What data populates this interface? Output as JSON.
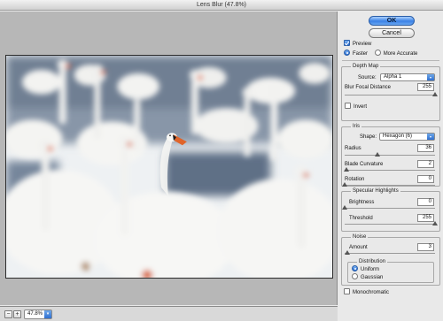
{
  "window": {
    "title": "Lens Blur (47.8%)"
  },
  "buttons": {
    "ok": "OK",
    "cancel": "Cancel"
  },
  "preview": {
    "label": "Preview",
    "checked": true,
    "mode_options": [
      "Faster",
      "More Accurate"
    ],
    "mode_selected": "Faster"
  },
  "depth_map": {
    "title": "Depth Map",
    "source_label": "Source:",
    "source_value": "Alpha 1",
    "focal_label": "Blur Focal Distance",
    "focal_value": "255",
    "focal_max": 255,
    "invert_label": "Invert",
    "invert_checked": false
  },
  "iris": {
    "title": "Iris",
    "shape_label": "Shape:",
    "shape_value": "Hexagon (6)",
    "radius_label": "Radius",
    "radius_value": "36",
    "radius_max": 100,
    "curvature_label": "Blade Curvature",
    "curvature_value": "2",
    "curvature_max": 100,
    "rotation_label": "Rotation",
    "rotation_value": "0",
    "rotation_max": 360
  },
  "specular": {
    "title": "Specular Highlights",
    "brightness_label": "Brightness",
    "brightness_value": "0",
    "brightness_max": 100,
    "threshold_label": "Threshold",
    "threshold_value": "255",
    "threshold_max": 255
  },
  "noise": {
    "title": "Noise",
    "amount_label": "Amount",
    "amount_value": "3",
    "amount_max": 100,
    "distribution_title": "Distribution",
    "distribution_options": [
      "Uniform",
      "Gaussian"
    ],
    "distribution_selected": "Uniform",
    "mono_label": "Monochromatic",
    "mono_checked": false
  },
  "status": {
    "zoom_value": "47.8%",
    "zoom_out": "−",
    "zoom_in": "+"
  },
  "colors": {
    "accent": "#3b82e6",
    "water": "#6f7f93",
    "swan": "#f3f3f1",
    "beak": "#e0642a"
  }
}
